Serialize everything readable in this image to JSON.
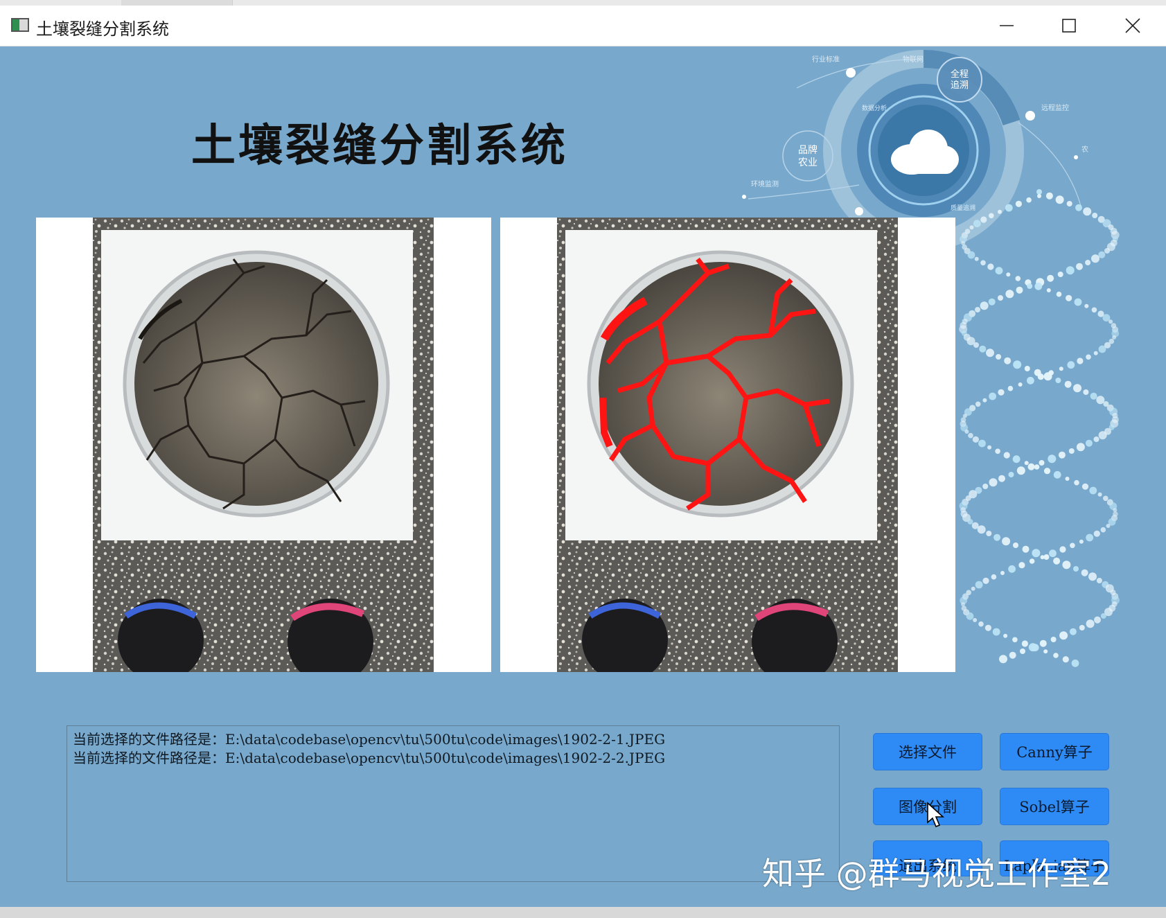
{
  "window": {
    "title": "土壤裂缝分割系统"
  },
  "header": {
    "title": "土壤裂缝分割系统"
  },
  "decor_labels": {
    "center_badge": "全程\n追溯",
    "left_badge": "品牌\n农业",
    "small": [
      "行业标准",
      "物联网",
      "远程监控",
      "环境监测",
      "质量追溯",
      "数据分析",
      "农"
    ]
  },
  "log": {
    "lines": [
      "当前选择的文件路径是：E:\\data\\codebase\\opencv\\tu\\500tu\\code\\images\\1902-2-1.JPEG",
      "当前选择的文件路径是：E:\\data\\codebase\\opencv\\tu\\500tu\\code\\images\\1902-2-2.JPEG"
    ]
  },
  "buttons": {
    "select_file": "选择文件",
    "canny": "Canny算子",
    "segment": "图像分割",
    "sobel": "Sobel算子",
    "exit": "退出系统",
    "laplacian": "Laplacian算子"
  },
  "watermark": "知乎 @群马视觉工作室2",
  "colors": {
    "client_bg": "#78a9cd",
    "button_bg": "#2e8bf5",
    "crack_highlight": "#ff1414"
  }
}
